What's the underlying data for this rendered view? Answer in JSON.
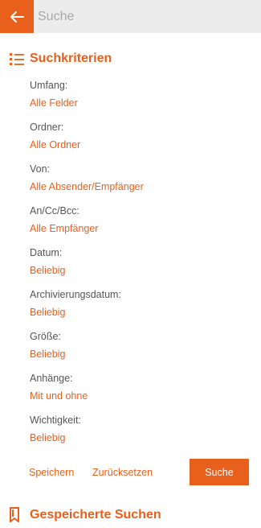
{
  "header": {
    "search_placeholder": "Suche"
  },
  "criteria_section": {
    "title": "Suchkriterien",
    "icon": "list-icon",
    "items": [
      {
        "label": "Umfang:",
        "value": "Alle Felder"
      },
      {
        "label": "Ordner:",
        "value": "Alle Ordner"
      },
      {
        "label": "Von:",
        "value": "Alle Absender/Empfänger"
      },
      {
        "label": "An/Cc/Bcc:",
        "value": "Alle Empfänger"
      },
      {
        "label": "Datum:",
        "value": "Beliebig"
      },
      {
        "label": "Archivierungsdatum:",
        "value": "Beliebig"
      },
      {
        "label": "Größe:",
        "value": "Beliebig"
      },
      {
        "label": "Anhänge:",
        "value": "Mit und ohne"
      },
      {
        "label": "Wichtigkeit:",
        "value": "Beliebig"
      }
    ]
  },
  "actions": {
    "save_label": "Speichern",
    "reset_label": "Zurücksetzen",
    "search_label": "Suche"
  },
  "saved_section": {
    "title": "Gespeicherte Suchen",
    "icon": "bookmark-icon"
  },
  "colors": {
    "accent": "#e8601c",
    "search_bg": "#ececec",
    "label_text": "#555555"
  }
}
